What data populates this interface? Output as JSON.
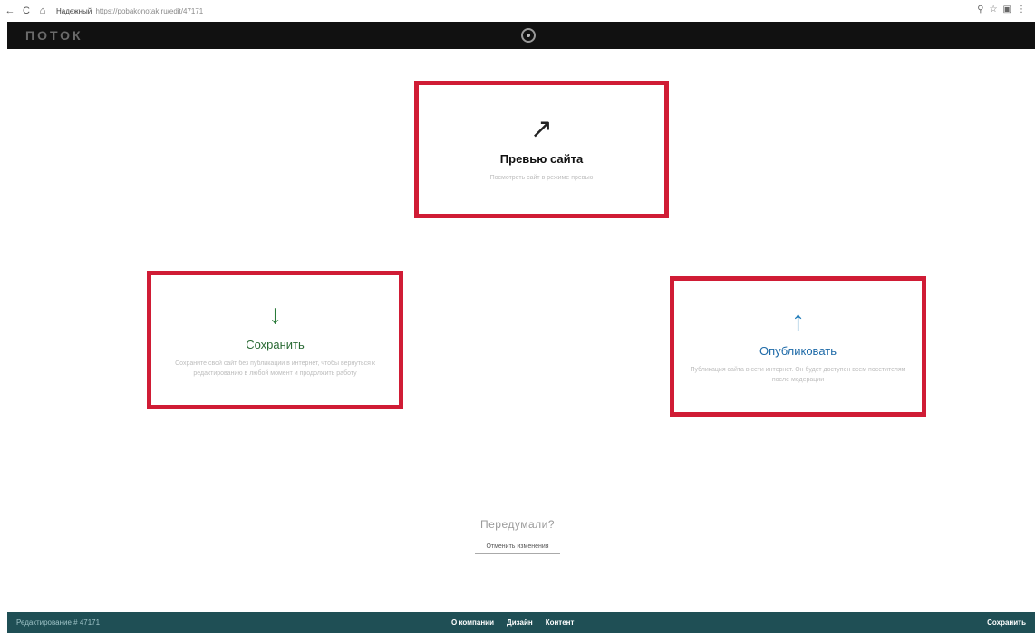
{
  "browser": {
    "back_icon": "←",
    "reload_icon": "C",
    "home_icon": "⌂",
    "secure_label": "Надежный",
    "url": "https://pobakonotak.ru/edit/47171",
    "right_icons": [
      "⚲",
      "☆",
      "▣",
      "⋮"
    ]
  },
  "header": {
    "logo": "ПОТОК"
  },
  "cards": {
    "preview": {
      "icon": "↗",
      "title": "Превью сайта",
      "desc": "Посмотреть сайт в режиме превью"
    },
    "save": {
      "icon": "↓",
      "title": "Сохранить",
      "desc": "Сохраните свой сайт без публикации в интернет, чтобы вернуться к редактированию в любой момент и продолжить работу"
    },
    "publish": {
      "icon": "↑",
      "title": "Опубликовать",
      "desc": "Публикация сайта в сети интернет. Он будет доступен всем посетителям после модерации"
    }
  },
  "rethink": {
    "question": "Передумали?",
    "undo_label": "Отменить изменения"
  },
  "footer": {
    "edit_label": "Редактирование # 47171",
    "nav": [
      "О компании",
      "Дизайн",
      "Контент"
    ],
    "save_label": "Сохранить"
  },
  "colors": {
    "card_border": "#d01c35",
    "save_accent": "#2a7a3a",
    "publish_accent": "#1e7ab8",
    "footer_bg": "#1f4f55"
  }
}
